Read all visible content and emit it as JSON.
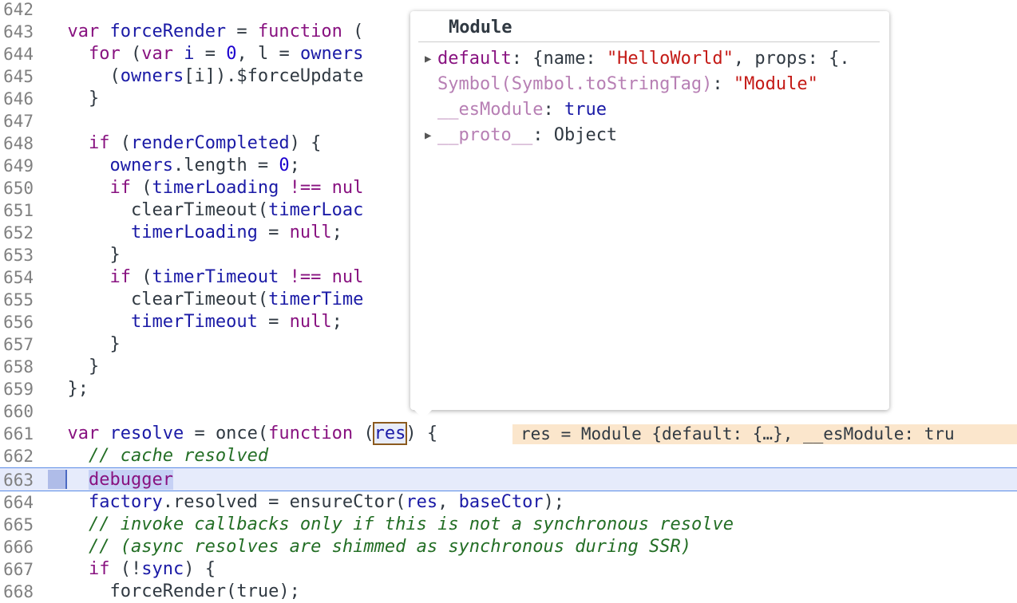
{
  "editor": {
    "lines": [
      {
        "n": "642"
      },
      {
        "n": "643",
        "html_parts": [
          "var",
          "forceRender",
          "=",
          "function",
          "("
        ]
      },
      {
        "n": "644"
      },
      {
        "n": "645"
      },
      {
        "n": "646"
      },
      {
        "n": "647"
      },
      {
        "n": "648"
      },
      {
        "n": "649"
      },
      {
        "n": "650"
      },
      {
        "n": "651"
      },
      {
        "n": "652"
      },
      {
        "n": "653"
      },
      {
        "n": "654"
      },
      {
        "n": "655"
      },
      {
        "n": "656"
      },
      {
        "n": "657"
      },
      {
        "n": "658"
      },
      {
        "n": "659"
      },
      {
        "n": "660"
      },
      {
        "n": "661"
      },
      {
        "n": "662"
      },
      {
        "n": "663"
      },
      {
        "n": "664"
      },
      {
        "n": "665"
      },
      {
        "n": "666"
      },
      {
        "n": "667"
      },
      {
        "n": "668"
      }
    ],
    "code": {
      "l643a": "  var ",
      "l643b": "forceRender",
      "l643c": " = ",
      "l643d": "function",
      "l643e": " (",
      "l644a": "    for",
      "l644b": " (",
      "l644c": "var",
      "l644d": " i",
      "l644e": " = ",
      "l644f": "0",
      "l644g": ", l = ",
      "l644h": "owners",
      "l645a": "      (",
      "l645b": "owners",
      "l645c": "[i]).$forceUpdate",
      "l646": "    }",
      "l648a": "    if",
      "l648b": " (",
      "l648c": "renderCompleted",
      "l648d": ") {",
      "l649a": "      ",
      "l649b": "owners",
      "l649c": ".length = ",
      "l649d": "0",
      "l649e": ";",
      "l650a": "      if",
      "l650b": " (",
      "l650c": "timerLoading",
      "l650d": " !== ",
      "l650e": "nul",
      "l651a": "        clearTimeout(",
      "l651b": "timerLoac",
      "l652a": "        ",
      "l652b": "timerLoading",
      "l652c": " = ",
      "l652d": "null",
      "l652e": ";",
      "l653": "      }",
      "l654a": "      if",
      "l654b": " (",
      "l654c": "timerTimeout",
      "l654d": " !== ",
      "l654e": "nul",
      "l655a": "        clearTimeout(",
      "l655b": "timerTime",
      "l656a": "        ",
      "l656b": "timerTimeout",
      "l656c": " = ",
      "l656d": "null",
      "l656e": ";",
      "l657": "      }",
      "l658": "    }",
      "l659": "  };",
      "l661a": "  var ",
      "l661b": "resolve",
      "l661c": " = once(",
      "l661d": "function",
      "l661e": " (",
      "l661f": "res",
      "l661g": ") {",
      "l661inline": "res = Module {default: {…}, __esModule: tru",
      "l662": "    // cache resolved",
      "l663": "debugger",
      "l664a": "    ",
      "l664b": "factory",
      "l664c": ".resolved = ensureCtor(",
      "l664d": "res",
      "l664e": ", ",
      "l664f": "baseCtor",
      "l664g": ");",
      "l665": "    // invoke callbacks only if this is not a synchronous resolve",
      "l666": "    // (async resolves are shimmed as synchronous during SSR)",
      "l667a": "    if",
      "l667b": " (!",
      "l667c": "sync",
      "l667d": ") {",
      "l668": "      forceRender(true);"
    }
  },
  "popover": {
    "title": "Module",
    "rows": {
      "default_key": "default",
      "default_val_a": ": {name: ",
      "default_val_b": "\"HelloWorld\"",
      "default_val_c": ", props: {.",
      "symbol_key": "Symbol(Symbol.toStringTag)",
      "symbol_sep": ": ",
      "symbol_val": "\"Module\"",
      "esm_key": "__esModule",
      "esm_sep": ": ",
      "esm_val": "true",
      "proto_key": "__proto__",
      "proto_val": ": Object"
    }
  },
  "colors": {
    "keyword": "#881280",
    "variable": "#1a1aa6",
    "comment": "#236e25",
    "string": "#c41a16",
    "exec_line": "#e6ebfb"
  }
}
